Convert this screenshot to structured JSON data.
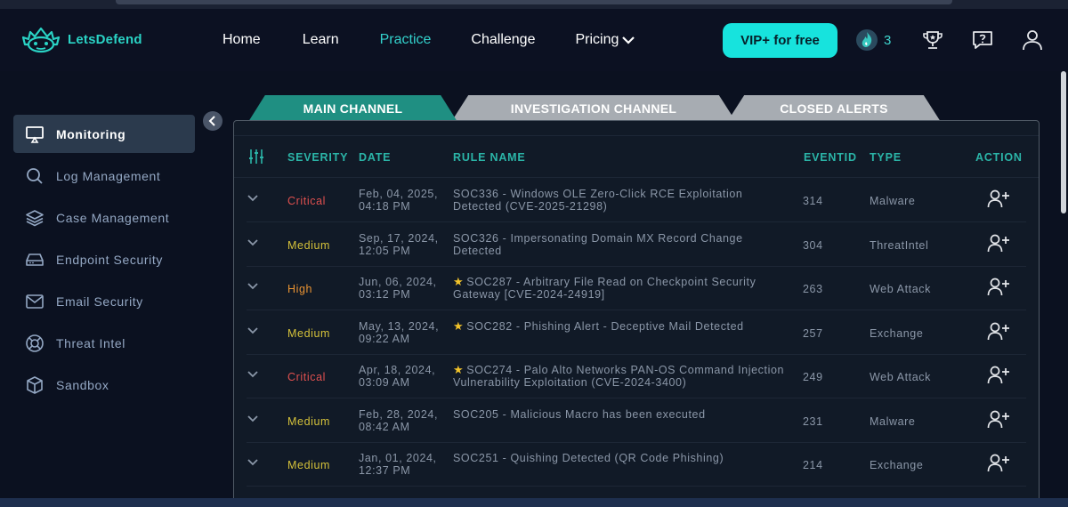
{
  "brand": {
    "name": "LetsDefend"
  },
  "nav": {
    "links": [
      {
        "label": "Home"
      },
      {
        "label": "Learn"
      },
      {
        "label": "Practice"
      },
      {
        "label": "Challenge"
      },
      {
        "label": "Pricing"
      }
    ],
    "active": "Practice",
    "vip_button": "VIP+ for free",
    "streak_count": "3",
    "icons": [
      "flame-badge-icon",
      "trophy-icon",
      "help-icon",
      "user-icon"
    ]
  },
  "sidebar": {
    "items": [
      {
        "label": "Monitoring",
        "icon": "monitor-icon",
        "active": true
      },
      {
        "label": "Log Management",
        "icon": "search-icon"
      },
      {
        "label": "Case Management",
        "icon": "layers-icon"
      },
      {
        "label": "Endpoint Security",
        "icon": "drive-icon"
      },
      {
        "label": "Email Security",
        "icon": "mail-icon"
      },
      {
        "label": "Threat Intel",
        "icon": "lifebuoy-icon"
      },
      {
        "label": "Sandbox",
        "icon": "box-icon"
      }
    ]
  },
  "tabs": [
    {
      "label": "MAIN CHANNEL",
      "active": true
    },
    {
      "label": "INVESTIGATION CHANNEL"
    },
    {
      "label": "CLOSED ALERTS"
    }
  ],
  "table": {
    "headers": {
      "severity": "SEVERITY",
      "date": "DATE",
      "rule": "RULE NAME",
      "eventid": "EVENTID",
      "type": "TYPE",
      "action": "ACTION"
    },
    "rows": [
      {
        "severity": "Critical",
        "date": "Feb, 04, 2025, 04:18 PM",
        "rule": "SOC336 - Windows OLE Zero-Click RCE Exploitation Detected (CVE-2025-21298)",
        "starred": false,
        "eventid": "314",
        "type": "Malware"
      },
      {
        "severity": "Medium",
        "date": "Sep, 17, 2024, 12:05 PM",
        "rule": "SOC326 - Impersonating Domain MX Record Change Detected",
        "starred": false,
        "eventid": "304",
        "type": "ThreatIntel"
      },
      {
        "severity": "High",
        "date": "Jun, 06, 2024, 03:12 PM",
        "rule": "SOC287 - Arbitrary File Read on Checkpoint Security Gateway [CVE-2024-24919]",
        "starred": true,
        "eventid": "263",
        "type": "Web Attack"
      },
      {
        "severity": "Medium",
        "date": "May, 13, 2024, 09:22 AM",
        "rule": "SOC282 - Phishing Alert - Deceptive Mail Detected",
        "starred": true,
        "eventid": "257",
        "type": "Exchange"
      },
      {
        "severity": "Critical",
        "date": "Apr, 18, 2024, 03:09 AM",
        "rule": "SOC274 - Palo Alto Networks PAN-OS Command Injection Vulnerability Exploitation (CVE-2024-3400)",
        "starred": true,
        "eventid": "249",
        "type": "Web Attack"
      },
      {
        "severity": "Medium",
        "date": "Feb, 28, 2024, 08:42 AM",
        "rule": "SOC205 - Malicious Macro has been executed",
        "starred": false,
        "eventid": "231",
        "type": "Malware"
      },
      {
        "severity": "Medium",
        "date": "Jan, 01, 2024, 12:37 PM",
        "rule": "SOC251 - Quishing Detected (QR Code Phishing)",
        "starred": false,
        "eventid": "214",
        "type": "Exchange"
      }
    ]
  },
  "colors": {
    "accent": "#17e3dd",
    "critical": "#e0504f",
    "medium": "#d4c13a",
    "high": "#e89232",
    "header_teal": "#2bb5a8"
  }
}
